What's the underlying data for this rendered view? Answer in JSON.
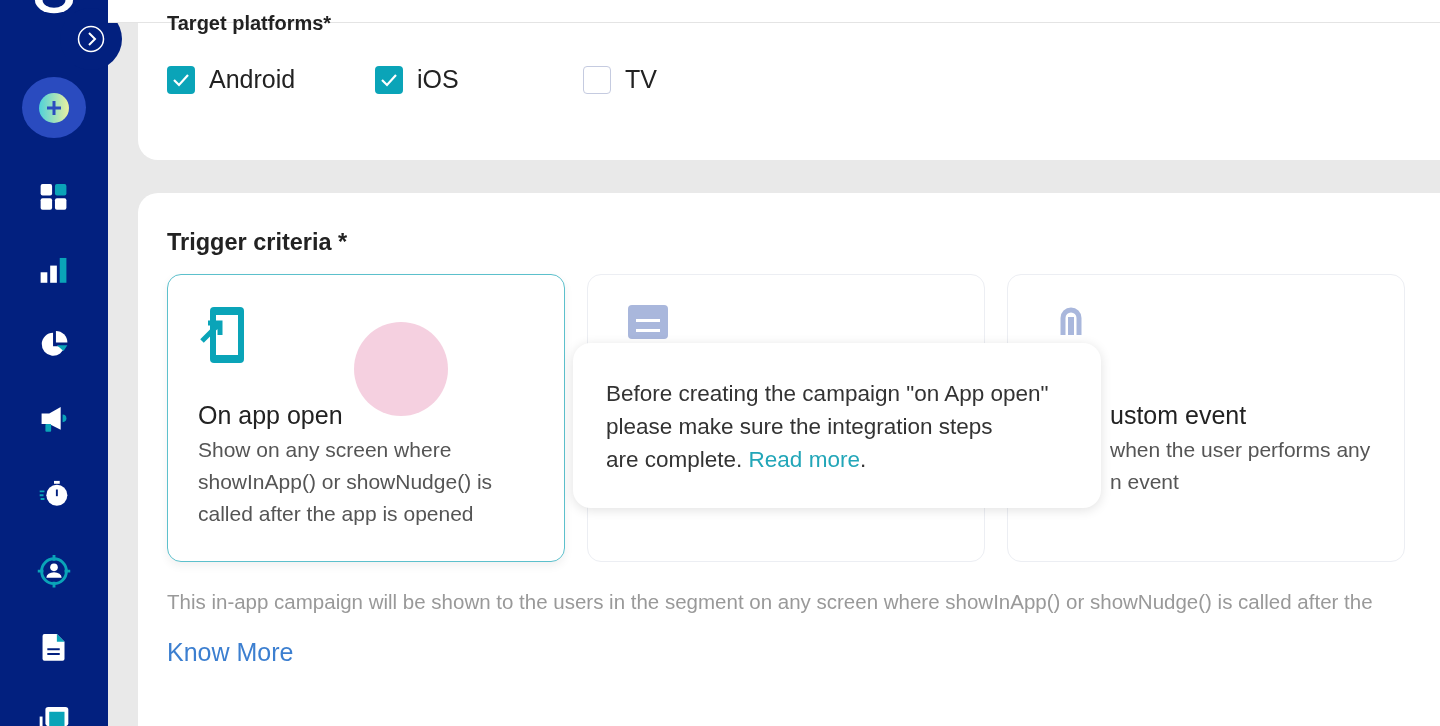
{
  "platforms": {
    "title": "Target platforms*",
    "options": [
      {
        "label": "Android",
        "checked": true
      },
      {
        "label": "iOS",
        "checked": true
      },
      {
        "label": "TV",
        "checked": false
      }
    ]
  },
  "trigger": {
    "title": "Trigger criteria *",
    "cards": [
      {
        "kind": "app_open",
        "selected": true,
        "title": "On app open",
        "lines": [
          "Show on any screen where",
          "showInApp() or showNudge() is",
          "called after the app is opened"
        ]
      },
      {
        "kind": "screen",
        "selected": false
      },
      {
        "kind": "event",
        "selected": false,
        "title": "ustom event",
        "lines": [
          "when the user performs any",
          "n event"
        ]
      }
    ],
    "note": "This in-app campaign will be shown to the users in the segment on any screen where showInApp() or showNudge() is called after the",
    "link": "Know More"
  },
  "tooltip": {
    "lines": [
      "Before creating the campaign \"on App open\"",
      "please make sure the integration steps",
      "are complete."
    ],
    "link": "Read more",
    "end": "."
  }
}
